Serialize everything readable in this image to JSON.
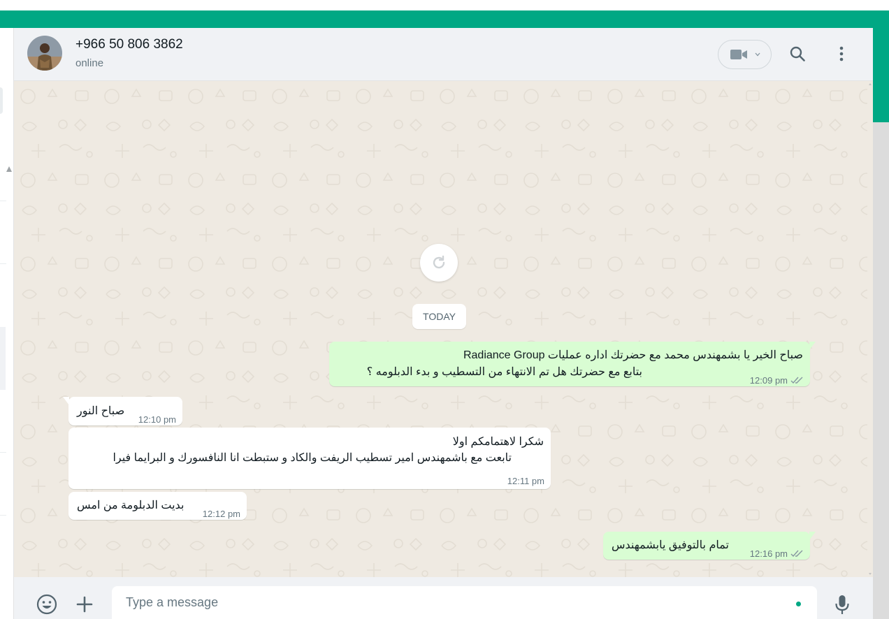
{
  "colors": {
    "accent": "#00a884",
    "outgoing_bubble": "#d9fdd3",
    "incoming_bubble": "#ffffff",
    "chat_bg": "#efeae2"
  },
  "header": {
    "contact_name": "+966 50 806 3862",
    "status": "online",
    "icons": [
      "video-icon",
      "chevron-down-icon",
      "search-icon",
      "menu-icon"
    ]
  },
  "chat": {
    "date_label": "TODAY",
    "messages": [
      {
        "direction": "out",
        "lines": [
          "صباح الخير يا بشمهندس محمد مع  حضرتك اداره عمليات Radiance Group",
          "بتابع مع حضرتك هل تم الانتهاء من التسطيب و بدء الدبلومه ؟"
        ],
        "time": "12:09 pm",
        "status": "read"
      },
      {
        "direction": "in",
        "lines": [
          "صباح النور"
        ],
        "time": "12:10 pm"
      },
      {
        "direction": "in",
        "lines": [
          "شكرا لاهتمامكم اولا",
          "تابعت مع باشمهندس امير تسطيب الريفت والكاد و ستبطت انا النافسورك و البرايما فيرا"
        ],
        "time": "12:11 pm"
      },
      {
        "direction": "in",
        "lines": [
          "بديت الدبلومة من امس"
        ],
        "time": "12:12 pm"
      },
      {
        "direction": "out",
        "lines": [
          "تمام بالتوفيق يابشمهندس"
        ],
        "time": "12:16 pm",
        "status": "read"
      }
    ]
  },
  "footer": {
    "placeholder": "Type a message",
    "icons": [
      "emoji-icon",
      "plus-icon",
      "mic-icon"
    ]
  }
}
